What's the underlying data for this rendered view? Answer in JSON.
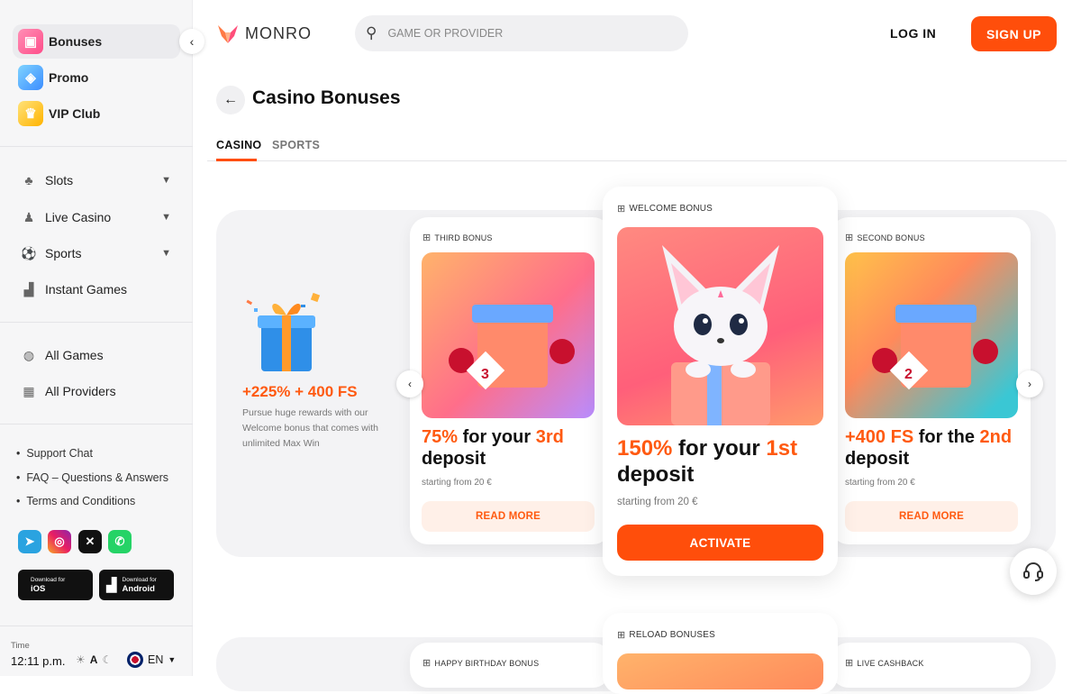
{
  "sidebar": {
    "top": [
      {
        "label": "Bonuses",
        "icon": "gift-icon"
      },
      {
        "label": "Promo",
        "icon": "promo-icon"
      },
      {
        "label": "VIP Club",
        "icon": "crown-icon"
      }
    ],
    "games": [
      {
        "label": "Slots",
        "icon": "cherry-icon"
      },
      {
        "label": "Live Casino",
        "icon": "dealer-icon"
      },
      {
        "label": "Sports",
        "icon": "ball-icon"
      },
      {
        "label": "Instant Games",
        "icon": "bar-chart-icon"
      }
    ],
    "catalog": [
      {
        "label": "All Games",
        "icon": "compass-icon"
      },
      {
        "label": "All Providers",
        "icon": "grid-icon"
      }
    ],
    "links": [
      "Support Chat",
      "FAQ – Questions & Answers",
      "Terms and Conditions"
    ],
    "social": [
      "telegram-icon",
      "instagram-icon",
      "x-icon",
      "whatsapp-icon"
    ],
    "stores": [
      {
        "small": "Download for",
        "big": "iOS"
      },
      {
        "small": "Download for",
        "big": "Android"
      }
    ],
    "time_label": "Time",
    "time_value": "12:11 p.m.",
    "theme_letter": "A",
    "language": "EN"
  },
  "header": {
    "logo": "MONRO",
    "search_placeholder": "GAME OR PROVIDER",
    "login": "LOG IN",
    "signup": "SIGN UP"
  },
  "page": {
    "title": "Casino Bonuses",
    "tabs": [
      "CASINO",
      "SPORTS"
    ],
    "active_tab": "CASINO"
  },
  "promo": {
    "amount": "+225% + 400 FS",
    "description": "Pursue huge rewards with our Welcome bonus that comes with unlimited Max Win"
  },
  "cards": [
    {
      "label": "THIRD BONUS",
      "t1": "75%",
      "t2": " for your ",
      "t3": "3rd",
      "t4": "deposit",
      "sub": "starting from 20 €",
      "button": "READ MORE"
    },
    {
      "label": "WELCOME BONUS",
      "t1": "150%",
      "t2": " for your ",
      "t3": "1st",
      "t4": "deposit",
      "sub": "starting from 20 €",
      "button": "ACTIVATE"
    },
    {
      "label": "SECOND BONUS",
      "t1": "+400 FS",
      "t2": " for the ",
      "t3": "2nd",
      "t4": "deposit",
      "sub": "starting from 20 €",
      "button": "READ MORE"
    }
  ],
  "cards_row2": [
    "HAPPY BIRTHDAY BONUS",
    "RELOAD BONUSES",
    "LIVE CASHBACK"
  ],
  "colors": {
    "accent": "#ff4e0b",
    "accent_text": "#ff5a11"
  }
}
